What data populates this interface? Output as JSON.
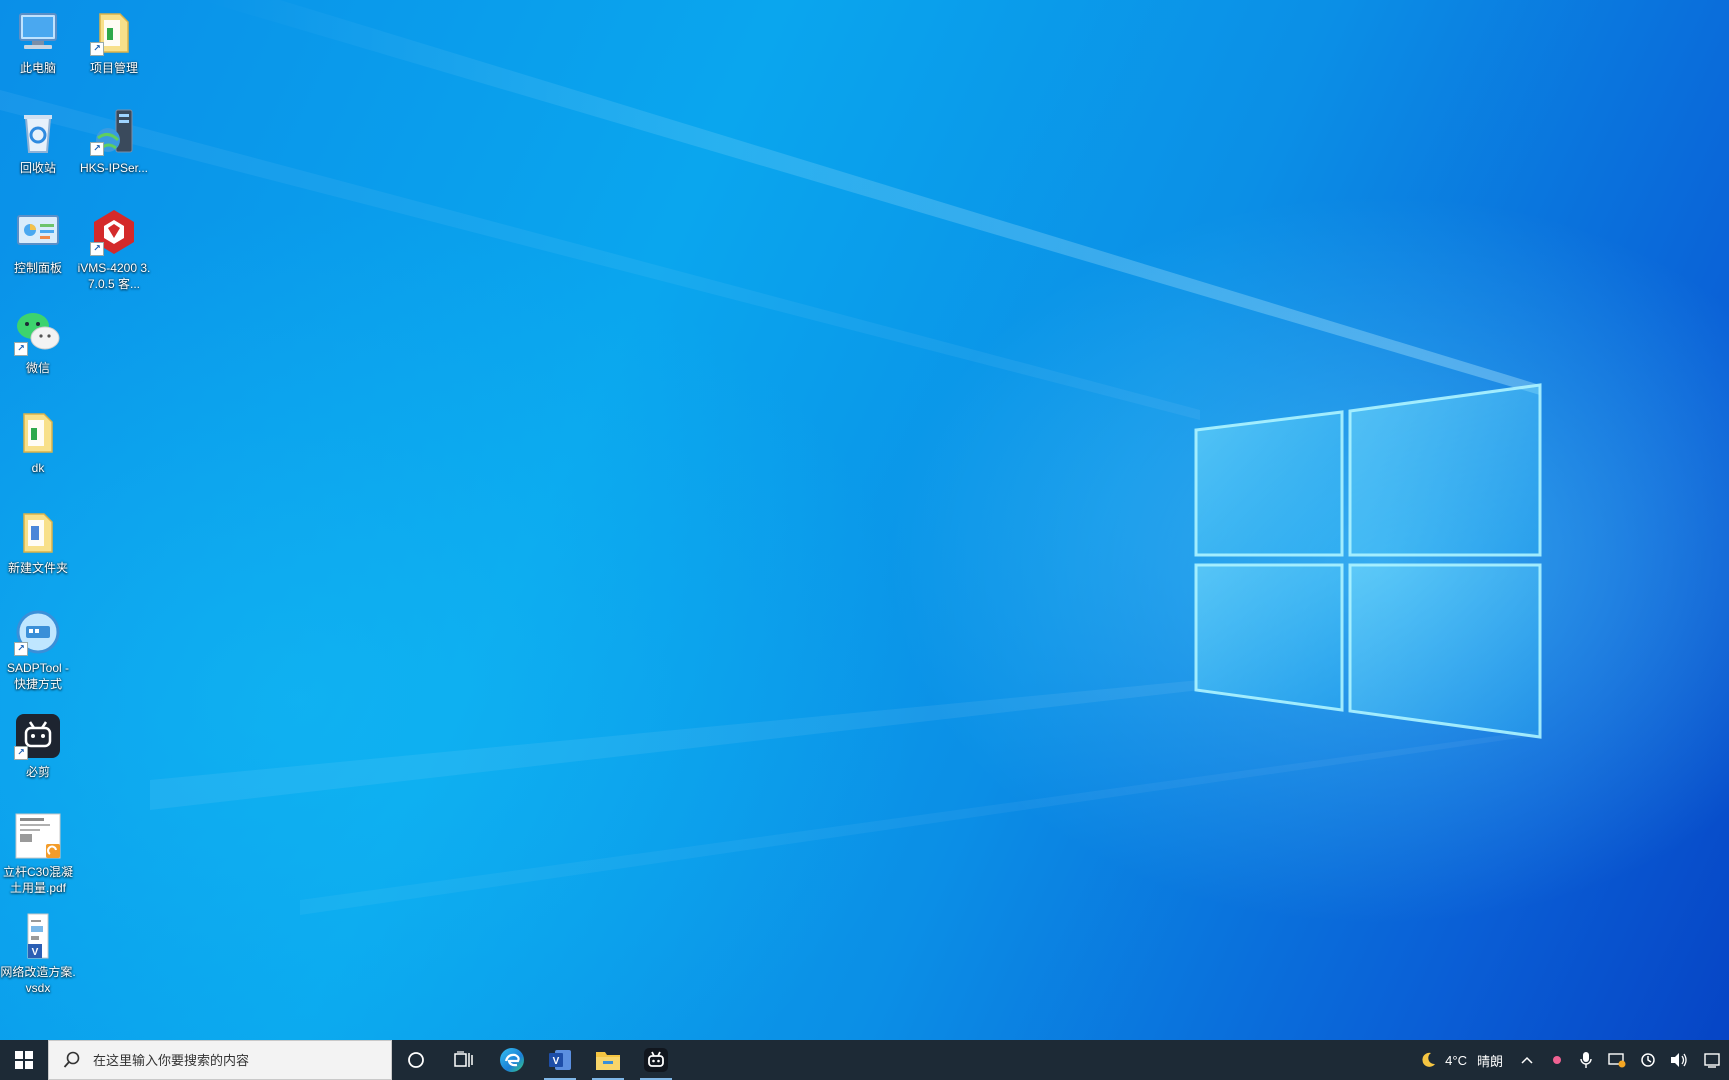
{
  "desktop": {
    "icons": [
      {
        "label": "此电脑"
      },
      {
        "label": "项目管理"
      },
      {
        "label": "回收站"
      },
      {
        "label": "HKS-IPSer..."
      },
      {
        "label": "控制面板"
      },
      {
        "label": "iVMS-4200 3.7.0.5 客..."
      },
      {
        "label": "微信"
      },
      {
        "label": "dk"
      },
      {
        "label": "新建文件夹"
      },
      {
        "label": "SADPTool - 快捷方式"
      },
      {
        "label": "必剪"
      },
      {
        "label": "立杆C30混凝土用量.pdf"
      },
      {
        "label": "网络改造方案.vsdx"
      }
    ]
  },
  "taskbar": {
    "search_placeholder": "在这里输入你要搜索的内容",
    "apps": [
      "cortana-icon",
      "task-view-icon",
      "edge-icon",
      "visio-icon",
      "file-explorer-icon",
      "bijian-icon"
    ],
    "weather": {
      "temp": "4°C",
      "condition": "晴朗"
    }
  },
  "colors": {
    "taskbar_bg": "#1d2a36",
    "accent": "#0a8fe8"
  }
}
